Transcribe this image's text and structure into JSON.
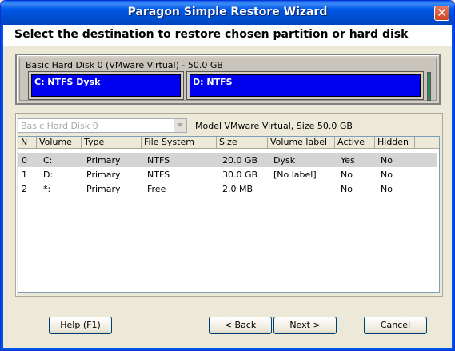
{
  "window": {
    "title": "Paragon Simple Restore Wizard",
    "close_glyph": "✕"
  },
  "header": {
    "text": "Select the destination to restore chosen partition or hard disk"
  },
  "disk_map": {
    "label": "Basic Hard Disk 0 (VMware Virtual) - 50.0 GB",
    "partitions": [
      {
        "label": "C: NTFS Dysk",
        "color": "#0000f0"
      },
      {
        "label": "D: NTFS",
        "color": "#0000f0"
      }
    ],
    "end_color": "#2e8b57"
  },
  "disk_select": {
    "value": "Basic Hard Disk 0",
    "model_info": "Model VMware Virtual, Size 50.0 GB"
  },
  "table": {
    "columns": [
      "N",
      "Volume",
      "Type",
      "File System",
      "Size",
      "Volume label",
      "Active",
      "Hidden"
    ],
    "rows": [
      {
        "n": "0",
        "volume": "C:",
        "type": "Primary",
        "fs": "NTFS",
        "size": "20.0 GB",
        "label": "Dysk",
        "active": "Yes",
        "hidden": "No",
        "selected": true
      },
      {
        "n": "1",
        "volume": "D:",
        "type": "Primary",
        "fs": "NTFS",
        "size": "30.0 GB",
        "label": "[No label]",
        "active": "No",
        "hidden": "No",
        "selected": false
      },
      {
        "n": "2",
        "volume": "*:",
        "type": "Primary",
        "fs": "Free",
        "size": "2.0 MB",
        "label": "",
        "active": "No",
        "hidden": "No",
        "selected": false
      }
    ]
  },
  "buttons": {
    "help": "Help (F1)",
    "back_prefix": "< ",
    "back_key": "B",
    "back_rest": "ack",
    "next_key": "N",
    "next_rest": "ext >",
    "cancel_key": "C",
    "cancel_rest": "ancel"
  }
}
